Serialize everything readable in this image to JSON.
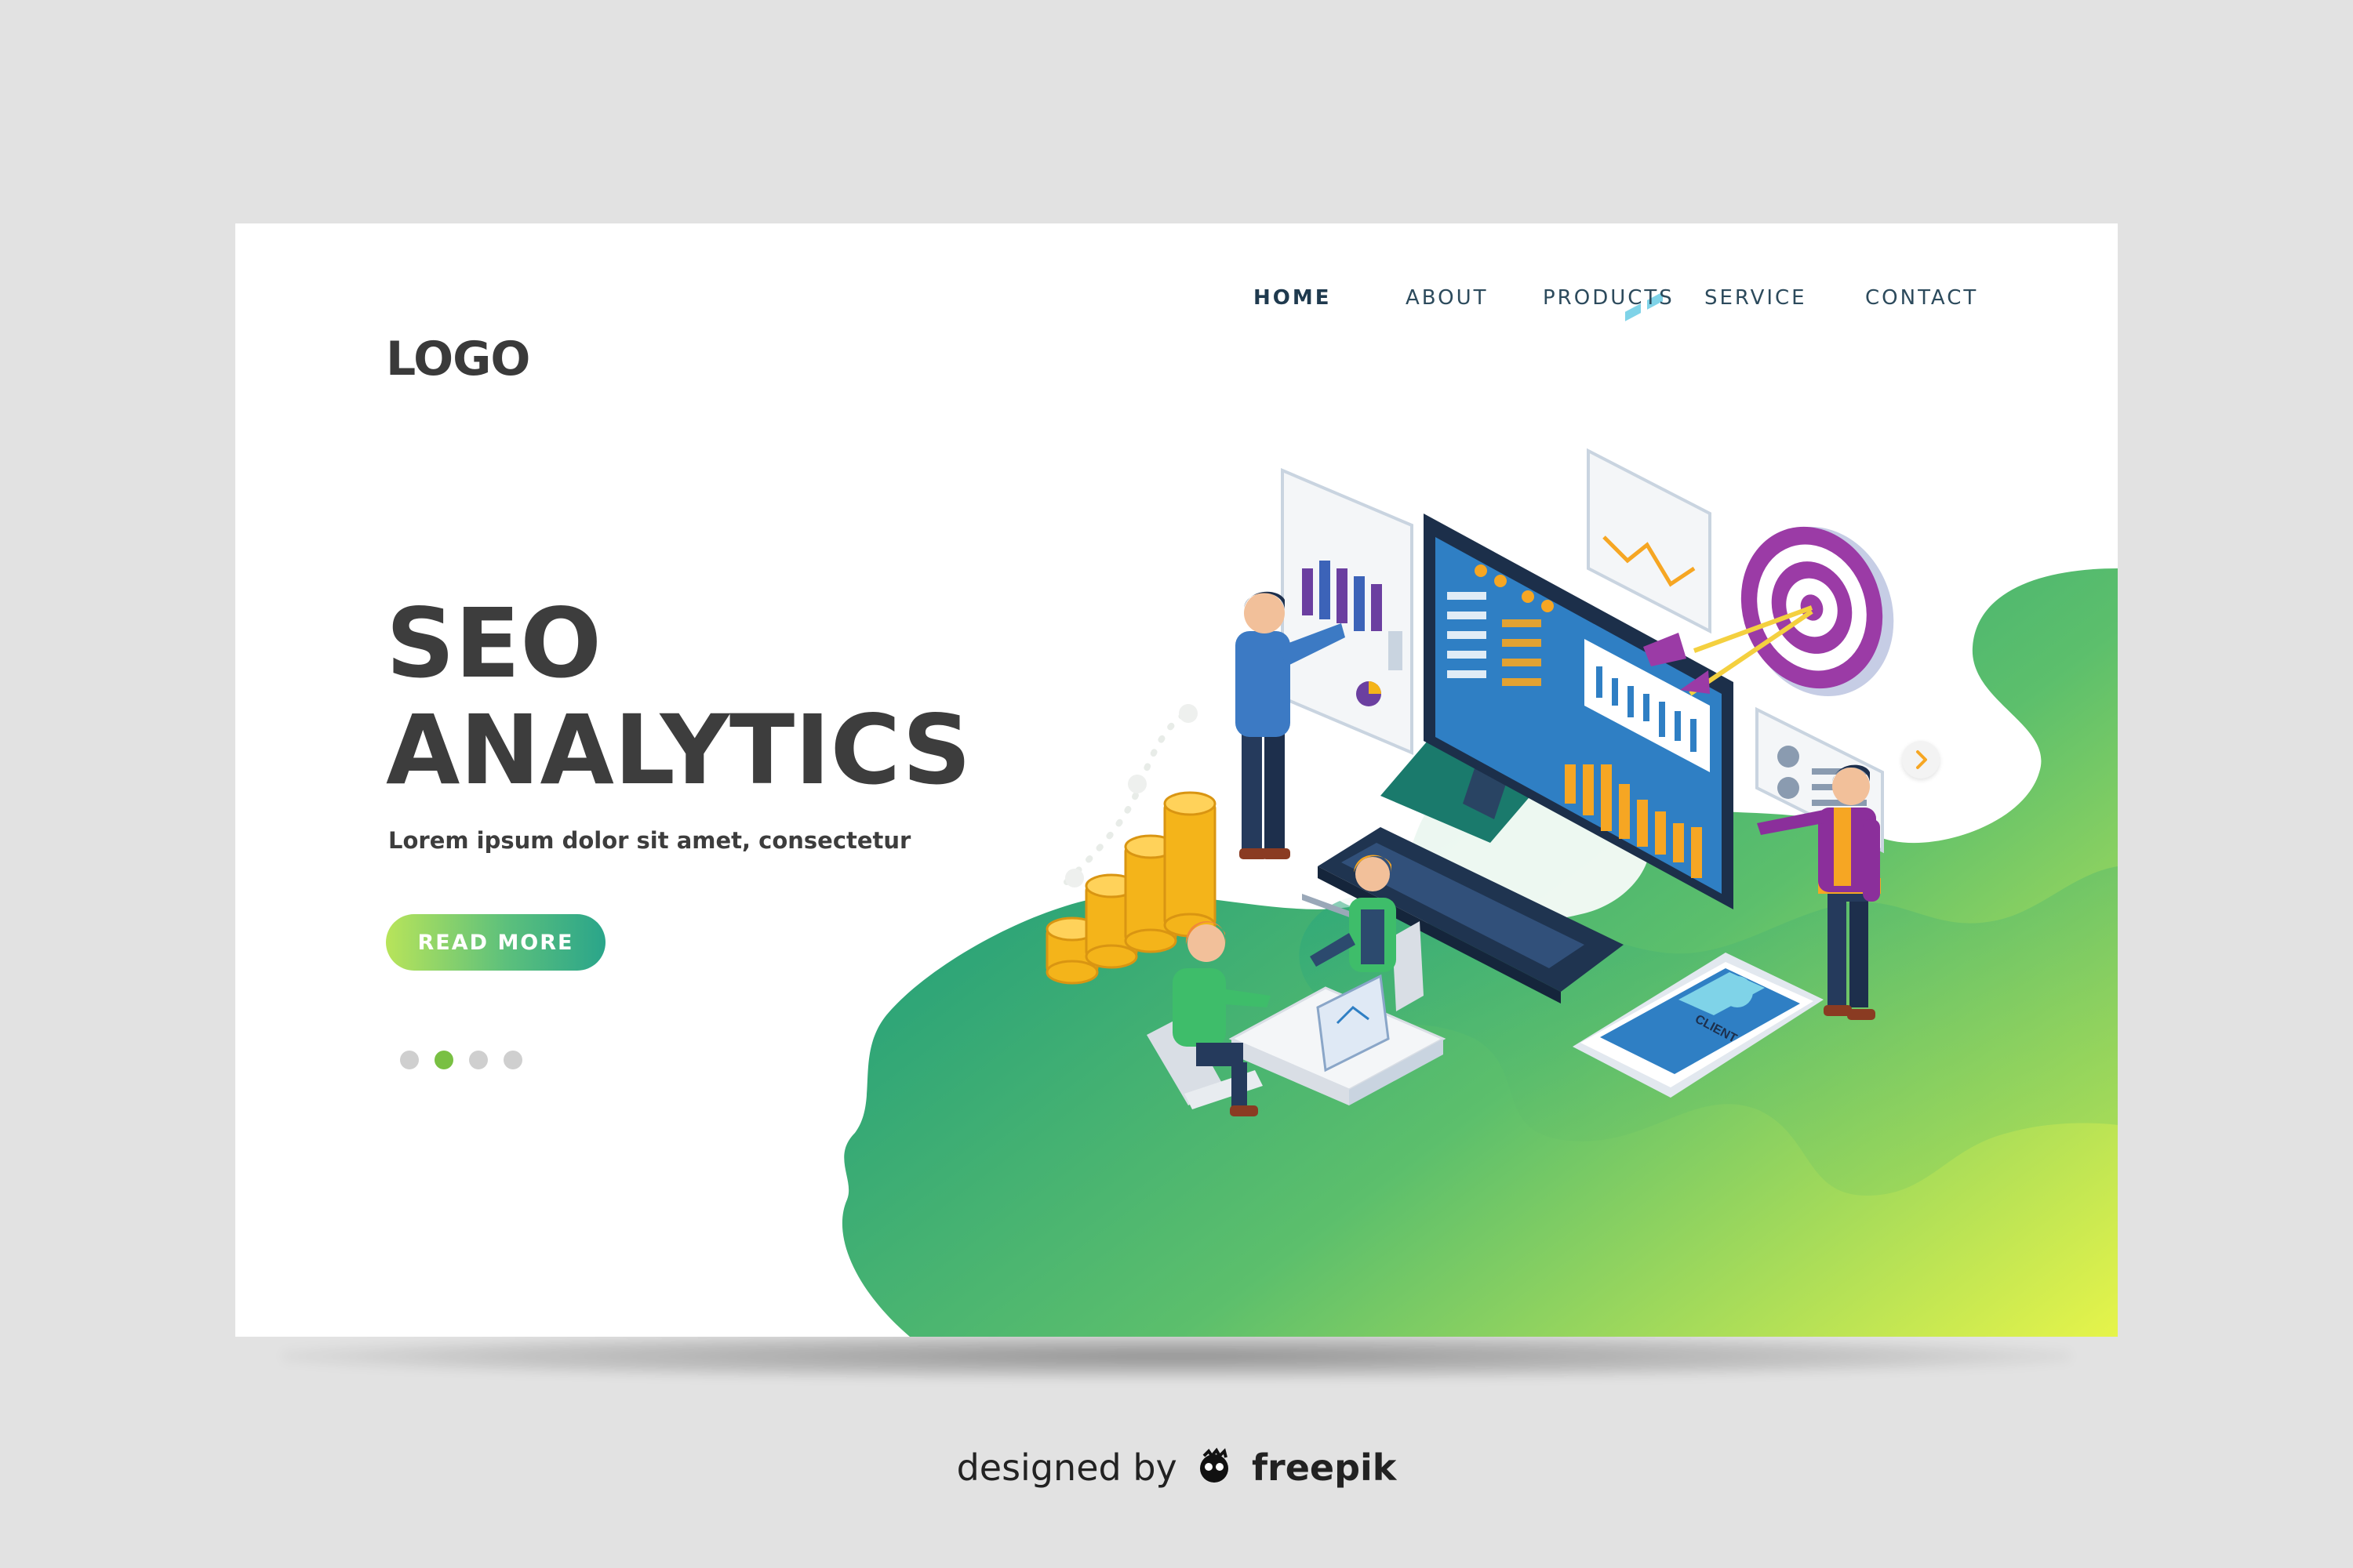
{
  "header": {
    "logo": "LOGO",
    "nav": [
      {
        "label": "HOME",
        "active": true
      },
      {
        "label": "ABOUT",
        "active": false
      },
      {
        "label": "PRODUCTS",
        "active": false
      },
      {
        "label": "SERVICE",
        "active": false
      },
      {
        "label": "CONTACT",
        "active": false
      }
    ]
  },
  "hero": {
    "title_line1": "SEO",
    "title_line2": "ANALYTICS",
    "subtitle": "Lorem ipsum dolor sit amet, consectetur",
    "cta_label": "READ MORE"
  },
  "carousel": {
    "dot_count": 4,
    "active_index": 1,
    "next_icon": "chevron-right-icon"
  },
  "illustration": {
    "phone_label": "CLIENT"
  },
  "credit": {
    "prefix": "designed by",
    "brand": "freepik"
  },
  "colors": {
    "accent_green": "#79c043",
    "blob_dark": "#14967e",
    "blob_light": "#e6f44a",
    "text_dark": "#3d3d3d",
    "nav_text": "#2c4a5c",
    "purple": "#9b3ba6",
    "monitor_blue": "#2f7fc4"
  }
}
